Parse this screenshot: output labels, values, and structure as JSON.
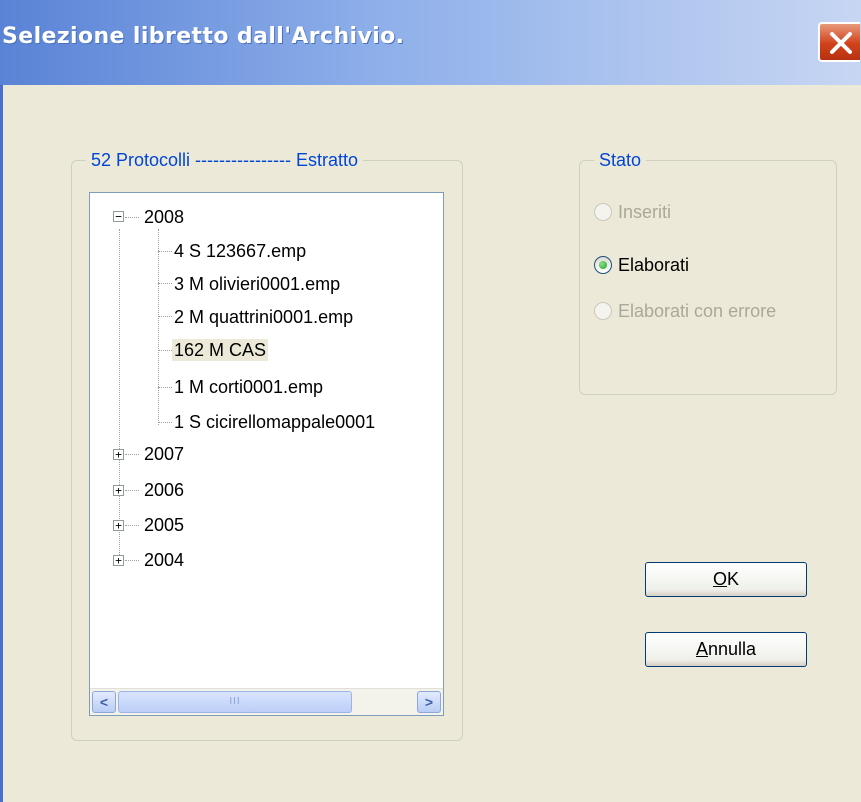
{
  "window": {
    "title": "Selezione libretto dall'Archivio."
  },
  "protocolli": {
    "legend": "52 Protocolli ---------------- Estratto",
    "years": [
      {
        "label": "2008",
        "expanded": true,
        "items": [
          {
            "label": "4 S 123667.emp"
          },
          {
            "label": "3 M olivieri0001.emp"
          },
          {
            "label": "2 M quattrini0001.emp"
          },
          {
            "label": "162 M CAS",
            "selected": true
          },
          {
            "label": "1 M corti0001.emp"
          },
          {
            "label": "1 S cicirellomappale0001"
          }
        ]
      },
      {
        "label": "2007",
        "expanded": false
      },
      {
        "label": "2006",
        "expanded": false
      },
      {
        "label": "2005",
        "expanded": false
      },
      {
        "label": "2004",
        "expanded": false
      }
    ],
    "expand_glyph": "+",
    "collapse_glyph": "−",
    "scrollbar": {
      "left_arrow": "<",
      "right_arrow": ">",
      "thumb_grip": "III"
    }
  },
  "stato": {
    "legend": "Stato",
    "options": [
      {
        "label": "Inseriti",
        "checked": false,
        "enabled": false
      },
      {
        "label": "Elaborati",
        "checked": true,
        "enabled": true
      },
      {
        "label": "Elaborati con errore",
        "checked": false,
        "enabled": false
      }
    ]
  },
  "buttons": {
    "ok": {
      "mnemonic": "O",
      "rest": "K"
    },
    "annulla": {
      "mnemonic": "A",
      "rest": "nnulla"
    }
  },
  "colors": {
    "title_bar": "#5a83d6",
    "legend_text": "#0046d5",
    "close_button": "#d1421b",
    "selected_item_bg": "#ece9d8"
  }
}
